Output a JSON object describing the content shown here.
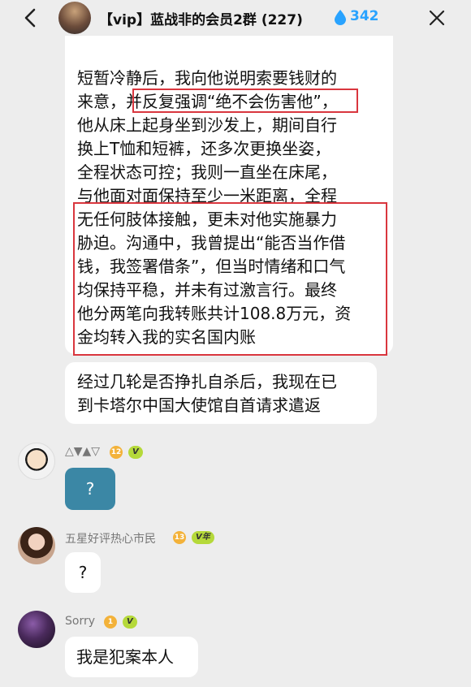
{
  "header": {
    "title": "【vip】蓝战非的会员2群 (227)",
    "drop_count": "342",
    "back_icon": "chevron-left-icon",
    "more_icon": "close-icon"
  },
  "message1": {
    "lines": [
      "短暂冷静后，我向他说明索要钱财的",
      "来意，并反复强调“绝不会伤害他”，",
      "他从床上起身坐到沙发上，期间自行",
      "换上T恤和短裤，还多次更换坐姿，",
      "全程状态可控；我则一直坐在床尾，",
      "与他面对面保持至少一米距离，全程",
      "无任何肢体接触，更未对他实施暴力",
      "胁迫。沟通中，我曾提出“能否当作借",
      "钱，我签署借条”，但当时情绪和口气",
      "均保持平稳，并未有过激言行。最终",
      "他分两笔向我转账共计108.8万元，资",
      "金均转入我的实名国内账"
    ]
  },
  "message2": {
    "lines": [
      "经过几轮是否挣扎自杀后，我现在已",
      "到卡塔尔中国大使馆自首请求遣返"
    ]
  },
  "user1": {
    "name": "△▼▲▽",
    "level": "12",
    "badge": "V",
    "message": "?"
  },
  "user2": {
    "name": "五星好评热心市民",
    "level": "13",
    "badge": "V年",
    "message": "?"
  },
  "user3": {
    "name": "Sorry",
    "level": "1",
    "badge": "V",
    "message": "我是犯案本人"
  },
  "colors": {
    "highlight_border": "#d9363e",
    "accent": "#29a3ff",
    "question_bubble": "#3b87a5",
    "background": "#ededed"
  }
}
